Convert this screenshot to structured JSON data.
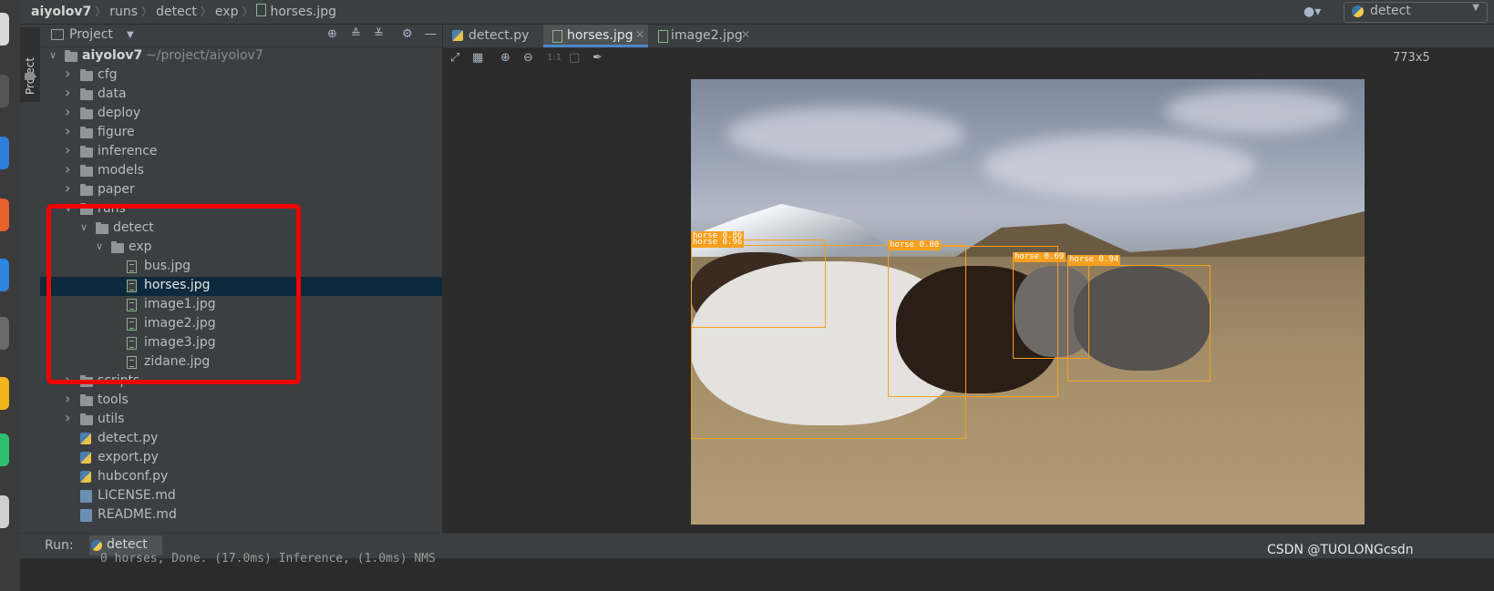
{
  "breadcrumbs": [
    "aiyolov7",
    "runs",
    "detect",
    "exp",
    "horses.jpg"
  ],
  "run_config": {
    "label": "detect"
  },
  "side_tab": {
    "label": "Project"
  },
  "project_panel": {
    "title": "Project",
    "tools": [
      "locate-icon",
      "expand-all-icon",
      "collapse-all-icon",
      "gear-icon",
      "minimize-icon"
    ]
  },
  "tree": [
    {
      "label": "aiyolov7",
      "sub": "~/project/aiyolov7",
      "type": "folder",
      "level": 0,
      "expanded": true
    },
    {
      "label": "cfg",
      "type": "folder",
      "level": 1,
      "expanded": false
    },
    {
      "label": "data",
      "type": "folder",
      "level": 1,
      "expanded": false
    },
    {
      "label": "deploy",
      "type": "folder",
      "level": 1,
      "expanded": false
    },
    {
      "label": "figure",
      "type": "folder",
      "level": 1,
      "expanded": false
    },
    {
      "label": "inference",
      "type": "folder",
      "level": 1,
      "expanded": false
    },
    {
      "label": "models",
      "type": "folder",
      "level": 1,
      "expanded": false
    },
    {
      "label": "paper",
      "type": "folder",
      "level": 1,
      "expanded": false
    },
    {
      "label": "runs",
      "type": "folder",
      "level": 1,
      "expanded": true
    },
    {
      "label": "detect",
      "type": "folder",
      "level": 2,
      "expanded": true
    },
    {
      "label": "exp",
      "type": "folder",
      "level": 3,
      "expanded": true
    },
    {
      "label": "bus.jpg",
      "type": "image",
      "level": 4
    },
    {
      "label": "horses.jpg",
      "type": "image",
      "level": 4,
      "selected": true
    },
    {
      "label": "image1.jpg",
      "type": "image",
      "level": 4
    },
    {
      "label": "image2.jpg",
      "type": "image",
      "level": 4
    },
    {
      "label": "image3.jpg",
      "type": "image",
      "level": 4
    },
    {
      "label": "zidane.jpg",
      "type": "image",
      "level": 4
    },
    {
      "label": "scripts",
      "type": "folder",
      "level": 1,
      "expanded": false
    },
    {
      "label": "tools",
      "type": "folder",
      "level": 1,
      "expanded": false
    },
    {
      "label": "utils",
      "type": "folder",
      "level": 1,
      "expanded": false
    },
    {
      "label": "detect.py",
      "type": "python",
      "level": 1
    },
    {
      "label": "export.py",
      "type": "python",
      "level": 1
    },
    {
      "label": "hubconf.py",
      "type": "python",
      "level": 1
    },
    {
      "label": "LICENSE.md",
      "type": "markdown",
      "level": 1
    },
    {
      "label": "README.md",
      "type": "markdown",
      "level": 1
    }
  ],
  "editor_tabs": [
    {
      "label": "detect.py",
      "type": "python",
      "active": false
    },
    {
      "label": "horses.jpg",
      "type": "image",
      "active": true
    },
    {
      "label": "image2.jpg",
      "type": "image",
      "active": false
    }
  ],
  "image_viewer": {
    "tools": [
      "fit-icon",
      "grid-icon",
      "zoom-in-icon",
      "zoom-out-icon",
      "actual-size-icon",
      "background-icon",
      "color-picker-icon"
    ],
    "actual_size_label": "1:1",
    "size_text": "773x5",
    "detections": [
      {
        "label": "horse 0.96",
        "color": "#f5a020"
      },
      {
        "label": "horse 0.86",
        "color": "#f5a020"
      },
      {
        "label": "horse 0.80",
        "color": "#f5a020"
      },
      {
        "label": "horse 0.69",
        "color": "#f5a020"
      },
      {
        "label": "horse 0.94",
        "color": "#f5a020"
      }
    ]
  },
  "run_bar": {
    "label": "Run:",
    "tab": "detect"
  },
  "console": {
    "text": "0 horses, Done. (17.0ms) Inference, (1.0ms) NMS"
  },
  "watermark": "CSDN @TUOLONGcsdn",
  "colors": {
    "highlight": "#f20000",
    "selection": "#0d293e",
    "accent": "#4a88c7"
  }
}
